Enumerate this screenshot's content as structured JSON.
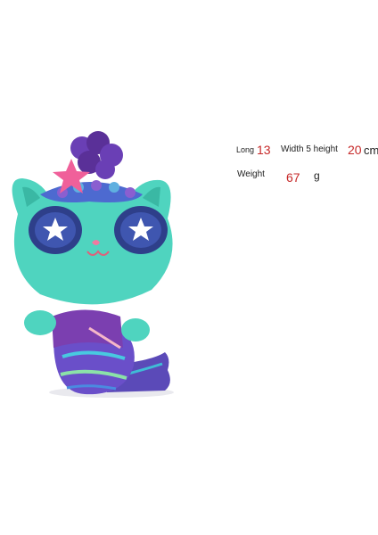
{
  "product": {
    "image_icon": "mermaid-cat-plush-icon",
    "colors": {
      "body": "#4fd4bf",
      "scales": "#6a3fb5",
      "eyes": "#2e3f8a",
      "star": "#f0609a"
    }
  },
  "specs": {
    "long_label": "Long",
    "long_value": "13",
    "width_height_label": "Width 5 height",
    "height_value": "20",
    "length_unit": "cm",
    "weight_label": "Weight",
    "weight_value": "67",
    "weight_unit": "g"
  }
}
